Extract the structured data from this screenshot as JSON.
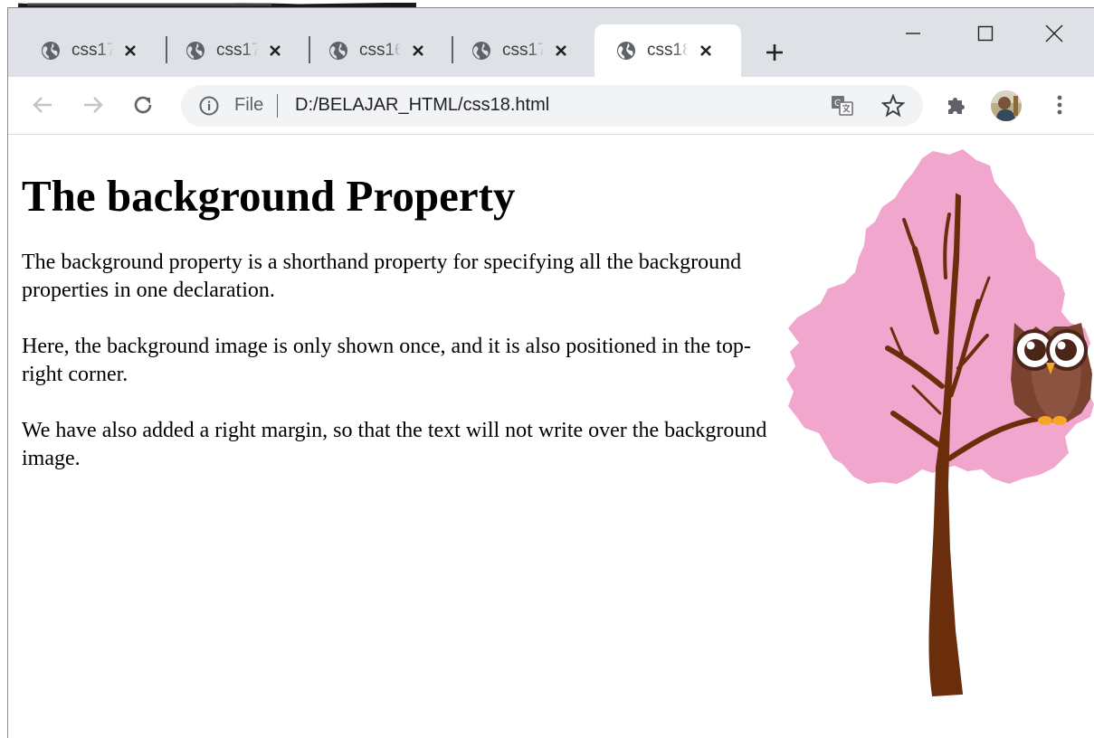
{
  "browser": {
    "tabs": [
      {
        "title": "css17",
        "active": false
      },
      {
        "title": "css17",
        "active": false
      },
      {
        "title": "css16",
        "active": false
      },
      {
        "title": "css17",
        "active": false
      },
      {
        "title": "css18",
        "active": true
      }
    ],
    "window_controls": {
      "minimize_icon": "minimize-icon",
      "maximize_icon": "maximize-icon",
      "close_icon": "close-icon"
    },
    "toolbar": {
      "back_icon": "arrow-left-icon",
      "forward_icon": "arrow-right-icon",
      "reload_icon": "reload-icon",
      "extensions_icon": "puzzle-icon",
      "menu_icon": "kebab-menu-icon"
    },
    "omnibox": {
      "scheme_label": "File",
      "url": "D:/BELAJAR_HTML/css18.html",
      "info_icon": "info-icon",
      "translate_icon": "translate-icon",
      "bookmark_icon": "star-icon"
    }
  },
  "page": {
    "heading": "The background Property",
    "paragraphs": [
      "The background property is a shorthand property for specifying all the background properties in one declaration.",
      "Here, the background image is only shown once, and it is also positioned in the top-right corner.",
      "We have also added a right margin, so that the text will not write over the background image."
    ],
    "background_image": "tree-with-owl"
  },
  "colors": {
    "tabstrip": "#dee1e6",
    "tree_leaves": "#f0a6cd",
    "tree_trunk": "#6b2e0c",
    "owl_body": "#7a4330"
  }
}
